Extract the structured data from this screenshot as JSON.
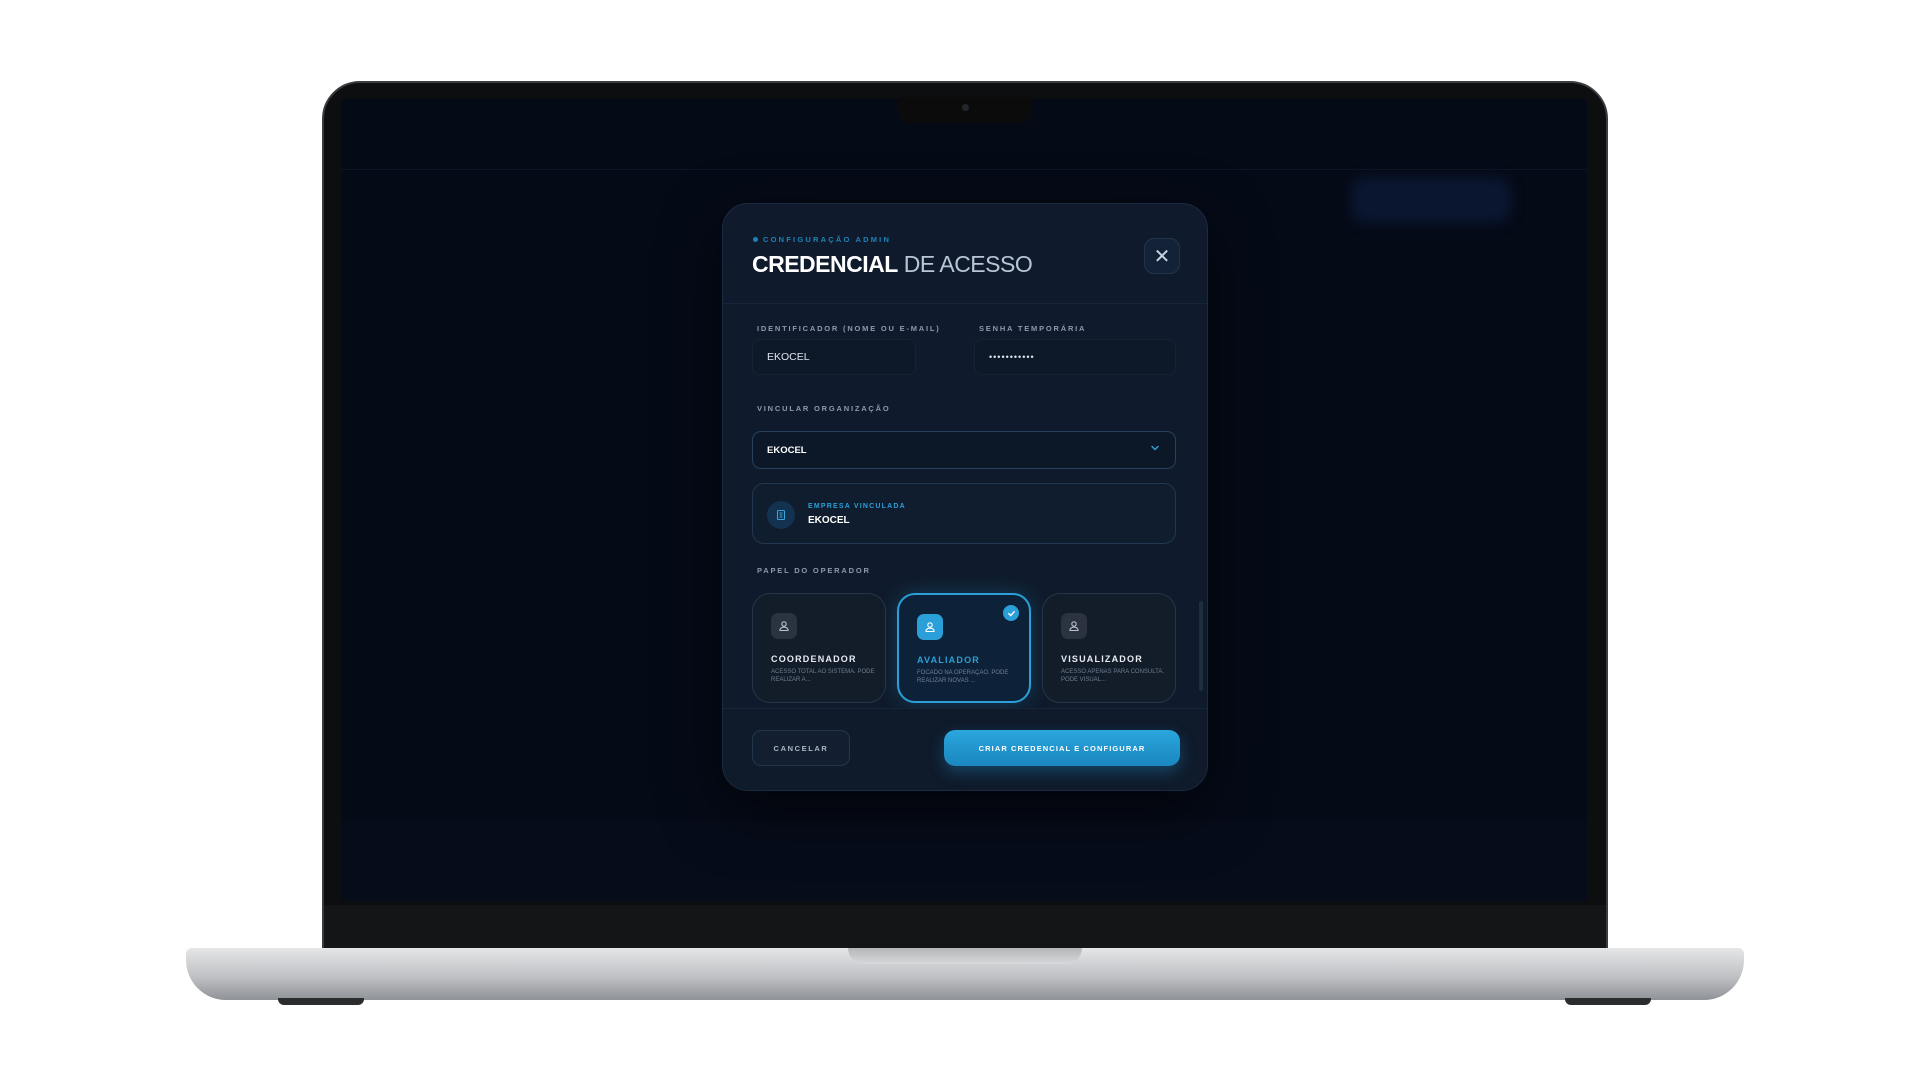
{
  "modal": {
    "eyebrow": "CONFIGURAÇÃO ADMIN",
    "title_strong": "CREDENCIAL",
    "title_light": "DE ACESSO",
    "close_glyph": "✕"
  },
  "form": {
    "identifier": {
      "label": "IDENTIFICADOR (NOME OU E-MAIL)",
      "value": "EKOCEL"
    },
    "password": {
      "label": "SENHA TEMPORÁRIA",
      "value": "•••••••••••"
    },
    "organization": {
      "label": "VINCULAR ORGANIZAÇÃO",
      "value": "EKOCEL"
    },
    "linked_company": {
      "label": "EMPRESA VINCULADA",
      "value": "EKOCEL"
    },
    "role": {
      "label": "PAPEL DO OPERADOR",
      "options": [
        {
          "name": "COORDENADOR",
          "desc": "ACESSO TOTAL AO SISTEMA. PODE REALIZAR A...",
          "selected": false
        },
        {
          "name": "AVALIADOR",
          "desc": "FOCADO NA OPERAÇÃO. PODE REALIZAR NOVAS ...",
          "selected": true
        },
        {
          "name": "VISUALIZADOR",
          "desc": "ACESSO APENAS PARA CONSULTA. PODE VISUAL...",
          "selected": false
        }
      ]
    }
  },
  "actions": {
    "cancel": "CANCELAR",
    "create": "CRIAR CREDENCIAL E CONFIGURAR"
  },
  "colors": {
    "accent": "#2a9fd8",
    "modal_bg": "#0f1b2c",
    "screen_bg": "#050a17"
  },
  "icons": {
    "close": "close-icon",
    "dropdown": "chevron-down-icon",
    "company": "building-icon",
    "role": "user-icon",
    "check": "check-icon"
  }
}
